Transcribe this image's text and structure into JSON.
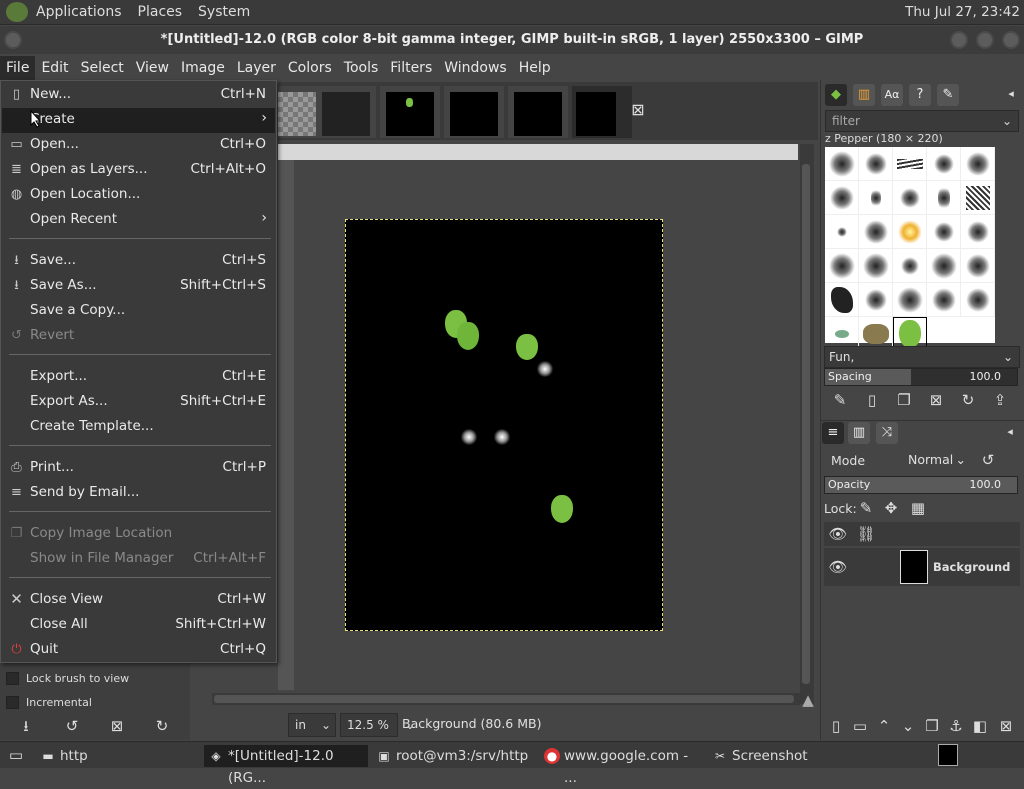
{
  "panel": {
    "menus": [
      "Applications",
      "Places",
      "System"
    ],
    "clock": "Thu Jul 27, 23:42"
  },
  "window": {
    "title": "*[Untitled]-12.0 (RGB color 8-bit gamma integer, GIMP built-in sRGB, 1 layer) 2550x3300 – GIMP"
  },
  "menubar": [
    "File",
    "Edit",
    "Select",
    "View",
    "Image",
    "Layer",
    "Colors",
    "Tools",
    "Filters",
    "Windows",
    "Help"
  ],
  "filemenu": {
    "new": {
      "label": "New...",
      "acc": "Ctrl+N"
    },
    "create": {
      "label": "Create"
    },
    "open": {
      "label": "Open...",
      "acc": "Ctrl+O"
    },
    "open_layers": {
      "label": "Open as Layers...",
      "acc": "Ctrl+Alt+O"
    },
    "open_location": {
      "label": "Open Location..."
    },
    "open_recent": {
      "label": "Open Recent"
    },
    "save": {
      "label": "Save...",
      "acc": "Ctrl+S"
    },
    "save_as": {
      "label": "Save As...",
      "acc": "Shift+Ctrl+S"
    },
    "save_copy": {
      "label": "Save a Copy..."
    },
    "revert": {
      "label": "Revert"
    },
    "export": {
      "label": "Export...",
      "acc": "Ctrl+E"
    },
    "export_as": {
      "label": "Export As...",
      "acc": "Shift+Ctrl+E"
    },
    "create_template": {
      "label": "Create Template..."
    },
    "print": {
      "label": "Print...",
      "acc": "Ctrl+P"
    },
    "send_email": {
      "label": "Send by Email..."
    },
    "copy_location": {
      "label": "Copy Image Location"
    },
    "show_manager": {
      "label": "Show in File Manager",
      "acc": "Ctrl+Alt+F"
    },
    "close_view": {
      "label": "Close View",
      "acc": "Ctrl+W"
    },
    "close_all": {
      "label": "Close All",
      "acc": "Shift+Ctrl+W"
    },
    "quit": {
      "label": "Quit",
      "acc": "Ctrl+Q"
    }
  },
  "tool_options": {
    "lock_brush": "Lock brush to view",
    "incremental": "Incremental"
  },
  "status": {
    "unit": "in",
    "zoom": "12.5 %",
    "info": "Background (80.6 MB)"
  },
  "brushes": {
    "filter_placeholder": "filter",
    "brush_name": "z Pepper (180 × 220)",
    "tag": "Fun,",
    "spacing_label": "Spacing",
    "spacing_value": "100.0"
  },
  "layers": {
    "mode_label": "Mode",
    "mode_value": "Normal",
    "opacity_label": "Opacity",
    "opacity_value": "100.0",
    "lock_label": "Lock:",
    "layer_name": "Background"
  },
  "taskbar": {
    "folder": "http",
    "gimp": "*[Untitled]-12.0 (RG...",
    "terminal": "root@vm3:/srv/http",
    "browser": "www.google.com - ...",
    "screenshot": "Screenshot"
  },
  "colors": {
    "menu_bg": "#3a3a3a",
    "highlight": "#1f1f1f",
    "pepper": "#7bc043"
  }
}
